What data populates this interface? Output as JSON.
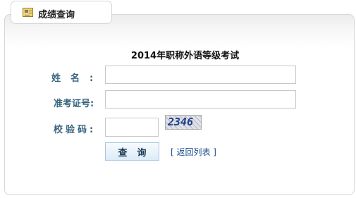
{
  "tab": {
    "title": "成绩查询",
    "icon": "score-query-icon"
  },
  "form": {
    "title": "2014年职称外语等级考试",
    "fields": {
      "name_label": "姓名:",
      "id_label": "准考证号:",
      "code_label": "校验码:",
      "name_value": "",
      "id_value": "",
      "code_value": ""
    },
    "captcha_text": "2346",
    "query_button": "查询",
    "back_link": "[ 返回列表 ]"
  },
  "colors": {
    "label": "#36627d",
    "link": "#1d4c8f",
    "border": "#d6d6d6"
  }
}
